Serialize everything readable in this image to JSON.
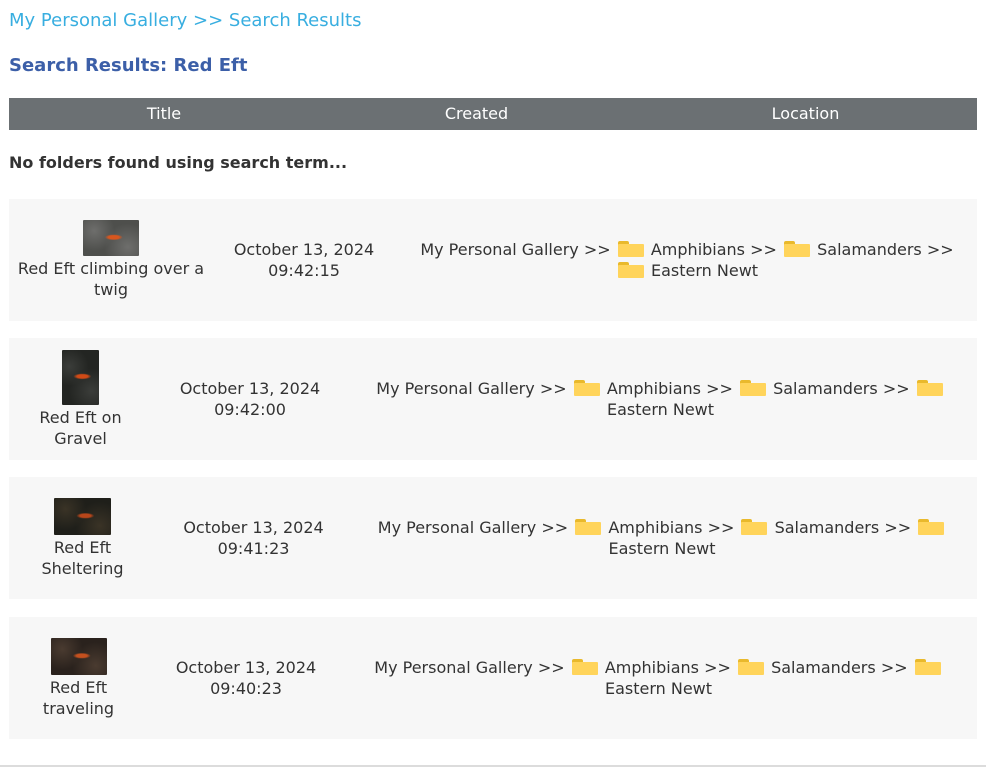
{
  "breadcrumb": {
    "root": "My Personal Gallery",
    "sep": ">>",
    "current": "Search Results"
  },
  "page_title": "Search Results: Red Eft",
  "table_headers": {
    "title": "Title",
    "created": "Created",
    "location": "Location"
  },
  "no_folders_message": "No folders found using search term...",
  "location_separator": ">>",
  "results": [
    {
      "title": "Red Eft climbing over a twig",
      "title_lines": [
        "Red Eft climbing over a",
        "twig"
      ],
      "date": "October 13, 2024",
      "time": "09:42:15",
      "location": [
        "My Personal Gallery",
        "Amphibians",
        "Salamanders",
        "Eastern Newt"
      ],
      "thumb_colors": [
        "#6e6e6c",
        "#4e4f4c",
        "#d8561e"
      ]
    },
    {
      "title": "Red Eft on Gravel",
      "title_lines": [
        "Red Eft on",
        "Gravel"
      ],
      "date": "October 13, 2024",
      "time": "09:42:00",
      "location": [
        "My Personal Gallery",
        "Amphibians",
        "Salamanders",
        "Eastern Newt"
      ],
      "thumb_colors": [
        "#3b3d3a",
        "#232522",
        "#d04a16"
      ]
    },
    {
      "title": "Red Eft Sheltering",
      "title_lines": [
        "Red Eft",
        "Sheltering"
      ],
      "date": "October 13, 2024",
      "time": "09:41:23",
      "location": [
        "My Personal Gallery",
        "Amphibians",
        "Salamanders",
        "Eastern Newt"
      ],
      "thumb_colors": [
        "#3a3326",
        "#1f1f1a",
        "#b8461a"
      ]
    },
    {
      "title": "Red Eft traveling",
      "title_lines": [
        "Red Eft",
        "traveling"
      ],
      "date": "October 13, 2024",
      "time": "09:40:23",
      "location": [
        "My Personal Gallery",
        "Amphibians",
        "Salamanders",
        "Eastern Newt"
      ],
      "thumb_colors": [
        "#4a3b30",
        "#2a221d",
        "#c4501e"
      ]
    }
  ]
}
